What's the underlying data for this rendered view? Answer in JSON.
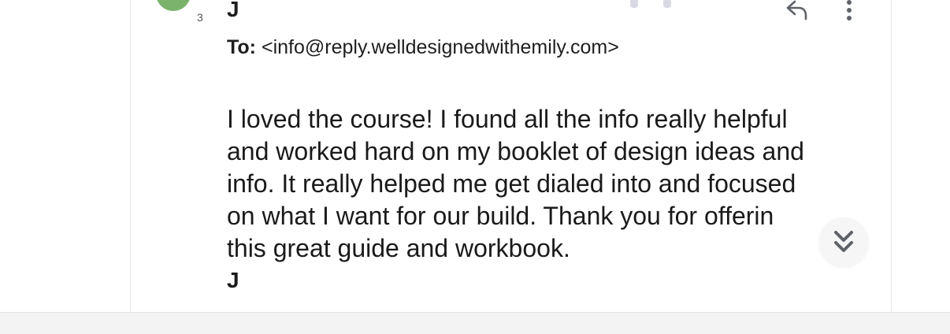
{
  "header": {
    "avatar_sub": "3",
    "sender_initial": "J",
    "icons": [
      "reply-icon",
      "more-vert-icon"
    ]
  },
  "to": {
    "label": "To:",
    "address": "<info@reply.welldesignedwithemily.com>"
  },
  "body": {
    "lines": [
      "I loved the course! I found all the info really helpful",
      "and worked hard on my booklet of design ideas and",
      "info. It really helped me get dialed into and focused",
      "on what I want for our build. Thank you for offerin",
      "this great guide and workbook."
    ]
  },
  "signature": "J",
  "scroll_button": {
    "icon": "double-chevron-down-icon"
  },
  "colors": {
    "avatar": "#7cb36c",
    "text": "#1a1a1a",
    "border": "#e6e6e6",
    "bottom_bar": "#f3f3f3"
  }
}
